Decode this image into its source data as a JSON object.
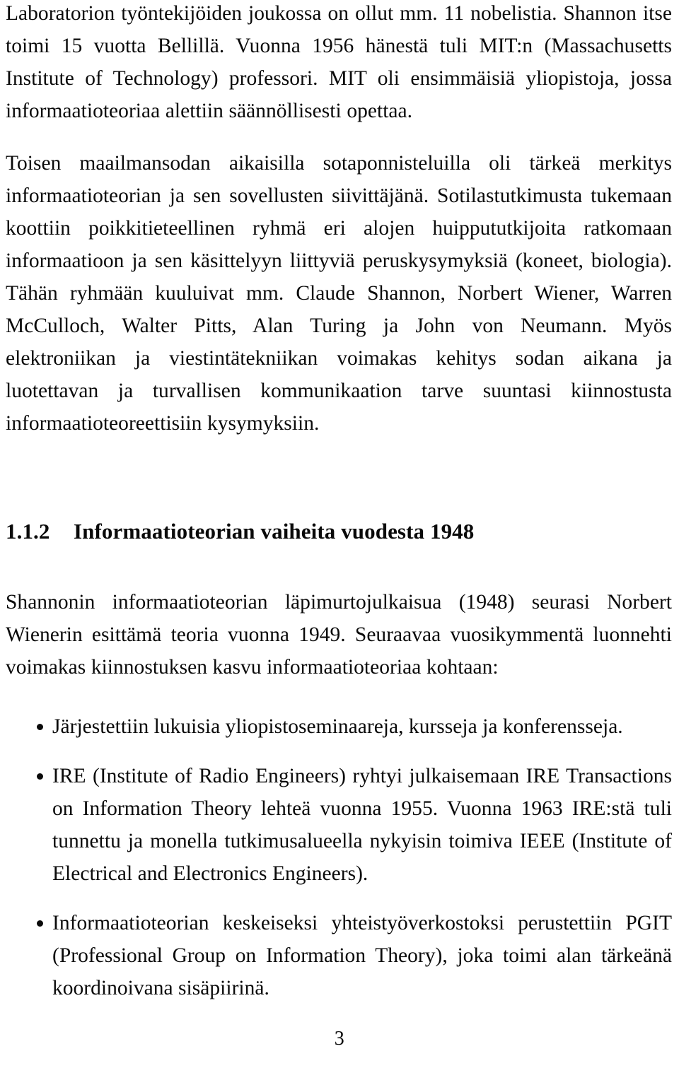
{
  "document": {
    "page_number": "3",
    "body": {
      "paragraphs": [
        "Laboratorion työntekijöiden joukossa on ollut mm. 11 nobelistia. Shannon itse toimi 15 vuotta Bellillä. Vuonna 1956 hänestä tuli MIT:n (Massachusetts Institute of Technology) professori. MIT oli ensimmäisiä yliopistoja, jossa informaatioteoriaa alettiin säännöllisesti opettaa.",
        "Toisen maailmansodan aikaisilla sotaponnisteluilla oli tärkeä merkitys informaatioteorian ja sen sovellusten siivittäjänä. Sotilastutkimusta tukemaan koottiin poikkitieteellinen ryhmä eri alojen huippututkijoita ratkomaan informaatioon ja sen käsittelyyn liittyviä peruskysymyksiä (koneet, biologia). Tähän ryhmään kuuluivat mm. Claude Shannon, Norbert Wiener, Warren McCulloch, Walter Pitts, Alan Turing ja John von Neumann. Myös elektroniikan ja viestintätekniikan voimakas kehitys sodan aikana ja luotettavan ja turvallisen kommunikaation tarve suuntasi kiinnostusta informaatioteoreettisiin kysymyksiin."
      ]
    },
    "section": {
      "number": "1.1.2",
      "title": "Informaatioteorian vaiheita vuodesta 1948",
      "intro_paragraph": "Shannonin informaatioteorian läpimurtojulkaisua (1948) seurasi Norbert Wienerin esittämä teoria vuonna 1949. Seuraavaa vuosikymmentä luonnehti voimakas kiinnostuksen kasvu informaatioteoriaa kohtaan:",
      "bullets": [
        "Järjestettiin lukuisia yliopistoseminaareja, kursseja ja konferensseja.",
        "IRE (Institute of Radio Engineers) ryhtyi julkaisemaan IRE Transactions on Information Theory lehteä vuonna 1955. Vuonna 1963 IRE:stä tuli tunnettu ja monella tutkimusalueella nykyisin toimiva IEEE (Institute of Electrical and Electronics Engineers).",
        "Informaatioteorian keskeiseksi yhteistyöverkostoksi perustettiin PGIT (Professional Group on Information Theory), joka toimi alan tärkeänä koordinoivana sisäpiirinä."
      ]
    }
  }
}
